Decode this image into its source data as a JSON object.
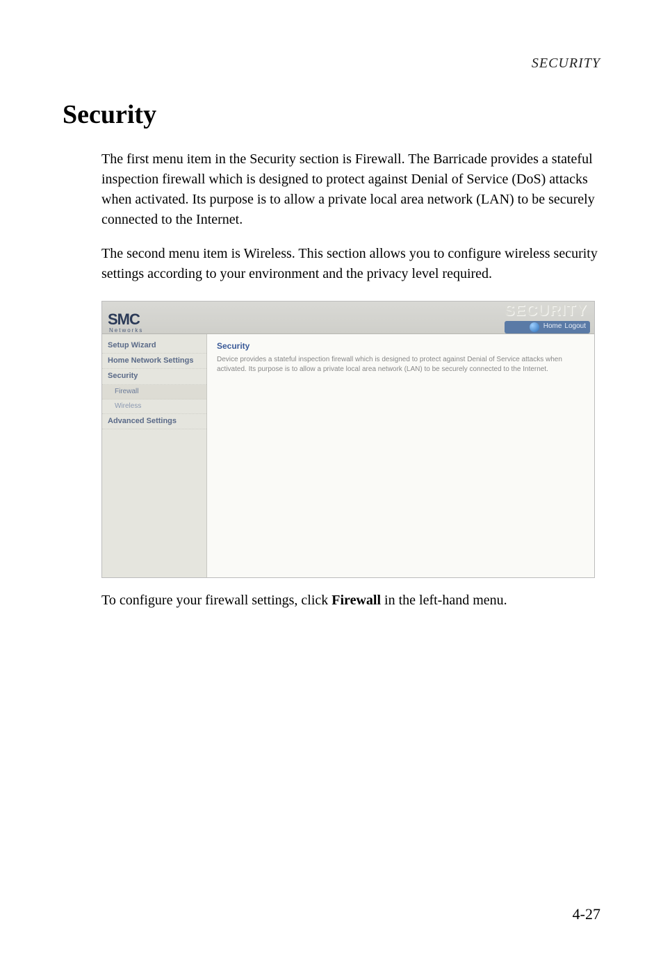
{
  "header": {
    "running": "SECURITY"
  },
  "title": "Security",
  "paragraphs": {
    "p1": "The first menu item in the Security section is Firewall. The Barricade provides a stateful inspection firewall which is designed to protect against Denial of Service (DoS) attacks when activated. Its purpose is to allow a private local area network (LAN) to be securely connected to the Internet.",
    "p2": "The second menu item is Wireless. This section allows you to configure wireless security settings according to your environment and the privacy level required."
  },
  "caption": {
    "pre": "To configure your firewall settings, click ",
    "bold": "Firewall",
    "post": " in the left-hand menu."
  },
  "page_number": "4-27",
  "router": {
    "logo": "SMC",
    "logo_tag": "Networks",
    "ghost_title": "SECURITY",
    "top_links": {
      "home": "Home",
      "logout": "Logout"
    },
    "nav": {
      "setup_wizard": "Setup Wizard",
      "home_network": "Home Network Settings",
      "security": "Security",
      "firewall": "Firewall",
      "wireless": "Wireless",
      "advanced": "Advanced Settings"
    },
    "panel": {
      "title": "Security",
      "desc": "Device provides a stateful inspection firewall which is designed to protect against Denial of Service attacks when activated. Its purpose is to allow a private local area network (LAN) to be securely connected to the Internet."
    }
  }
}
